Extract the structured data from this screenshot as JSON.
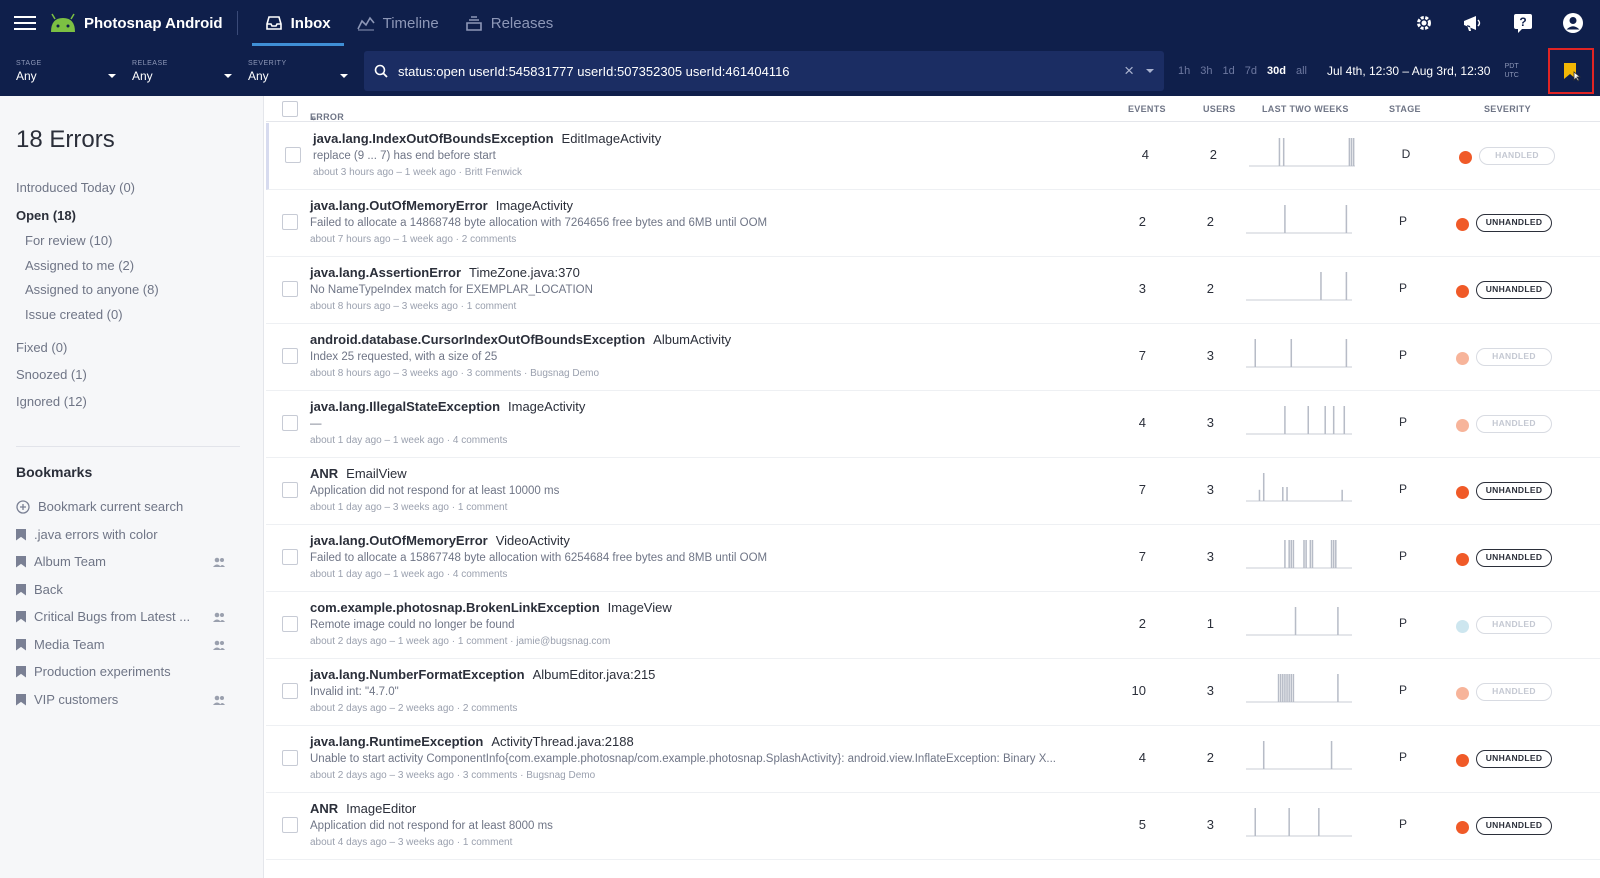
{
  "topbar": {
    "app_name": "Photosnap Android",
    "tabs": [
      {
        "label": "Inbox",
        "active": true,
        "icon": "inbox-icon"
      },
      {
        "label": "Timeline",
        "active": false,
        "icon": "timeline-icon"
      },
      {
        "label": "Releases",
        "active": false,
        "icon": "releases-icon"
      }
    ],
    "icons": [
      "settings-gear-icon",
      "megaphone-icon",
      "help-icon",
      "account-icon"
    ]
  },
  "filters": {
    "stage": {
      "label": "STAGE",
      "value": "Any"
    },
    "release": {
      "label": "RELEASE",
      "value": "Any"
    },
    "severity": {
      "label": "SEVERITY",
      "value": "Any"
    },
    "search_query": "status:open userId:545831777 userId:507352305 userId:461404116",
    "time_ranges": [
      "1h",
      "3h",
      "1d",
      "7d",
      "30d",
      "all"
    ],
    "active_range": "30d",
    "date_range": "Jul 4th, 12:30 – Aug 3rd, 12:30",
    "tz_top": "PDT",
    "tz_bottom": "UTC"
  },
  "sidebar": {
    "title": "18 Errors",
    "items": [
      {
        "label": "Introduced Today (0)"
      },
      {
        "label": "Open (18)"
      },
      {
        "label": "For review (10)"
      },
      {
        "label": "Assigned to me (2)"
      },
      {
        "label": "Assigned to anyone (8)"
      },
      {
        "label": "Issue created (0)"
      },
      {
        "label": "Fixed (0)"
      },
      {
        "label": "Snoozed (1)"
      },
      {
        "label": "Ignored (12)"
      }
    ],
    "bookmarks_title": "Bookmarks",
    "bookmarks": [
      {
        "label": "Bookmark current search"
      },
      {
        "label": ".java errors with color"
      },
      {
        "label": "Album Team"
      },
      {
        "label": "Back"
      },
      {
        "label": "Critical Bugs from Latest ..."
      },
      {
        "label": "Media Team"
      },
      {
        "label": "Production experiments"
      },
      {
        "label": "VIP customers"
      }
    ]
  },
  "table": {
    "headers": {
      "error": "ERROR",
      "events": "EVENTS",
      "users": "USERS",
      "trend": "LAST TWO WEEKS",
      "stage": "STAGE",
      "severity": "SEVERITY"
    },
    "rows": [
      {
        "name": "java.lang.IndexOutOfBoundsException",
        "context": "EditImageActivity",
        "message": "replace (9 ... 7) has end before start",
        "meta": "about 3 hours ago – 1 week ago  ·  Britt Fenwick",
        "events": "4",
        "users": "2",
        "stage": "D",
        "severity": "HANDLED",
        "dot_color": "#f05a28",
        "bars": [
          0,
          0,
          0,
          0,
          0,
          0,
          0,
          0,
          0,
          0,
          0,
          0,
          0,
          0,
          1,
          0,
          1,
          0,
          0,
          0,
          0,
          0,
          0,
          0,
          0,
          0,
          0,
          0,
          0,
          0,
          0,
          0,
          0,
          0,
          0,
          0,
          0,
          0,
          0,
          0,
          0,
          0,
          0,
          0,
          0,
          0,
          0,
          1,
          1,
          1
        ]
      },
      {
        "name": "java.lang.OutOfMemoryError",
        "context": "ImageActivity",
        "message": "Failed to allocate a 14868748 byte allocation with 7264656 free bytes and 6MB until OOM",
        "meta": "about 7 hours ago – 1 week ago  ·  2 comments",
        "events": "2",
        "users": "2",
        "stage": "P",
        "severity": "UNHANDLED",
        "dot_color": "#f05a28",
        "bars": [
          0,
          0,
          0,
          0,
          0,
          0,
          0,
          0,
          0,
          0,
          0,
          0,
          0,
          0,
          0,
          0,
          0,
          0,
          1,
          0,
          0,
          0,
          0,
          0,
          0,
          0,
          0,
          0,
          0,
          0,
          0,
          0,
          0,
          0,
          0,
          0,
          0,
          0,
          0,
          0,
          0,
          0,
          0,
          0,
          0,
          0,
          0,
          1,
          0,
          0
        ]
      },
      {
        "name": "java.lang.AssertionError",
        "context": "TimeZone.java:370",
        "message": "No NameTypeIndex match for EXEMPLAR_LOCATION",
        "meta": "about 8 hours ago – 3 weeks ago  ·  1 comment",
        "events": "3",
        "users": "2",
        "stage": "P",
        "severity": "UNHANDLED",
        "dot_color": "#f05a28",
        "bars": [
          0,
          0,
          0,
          0,
          0,
          0,
          0,
          0,
          0,
          0,
          0,
          0,
          0,
          0,
          0,
          0,
          0,
          0,
          0,
          0,
          0,
          0,
          0,
          0,
          0,
          0,
          0,
          0,
          0,
          0,
          0,
          0,
          0,
          0,
          0,
          1,
          0,
          0,
          0,
          0,
          0,
          0,
          0,
          0,
          0,
          0,
          0,
          1,
          0,
          0
        ]
      },
      {
        "name": "android.database.CursorIndexOutOfBoundsException",
        "context": "AlbumActivity",
        "message": "Index 25 requested, with a size of 25",
        "meta": "about 8 hours ago – 3 weeks ago  ·  3 comments  ·  Bugsnag Demo",
        "events": "7",
        "users": "3",
        "stage": "P",
        "severity": "HANDLED",
        "dot_color": "#f7b49a",
        "bars": [
          0,
          0,
          0,
          0,
          1,
          0,
          0,
          0,
          0,
          0,
          0,
          0,
          0,
          0,
          0,
          0,
          0,
          0,
          0,
          0,
          0,
          1,
          0,
          0,
          0,
          0,
          0,
          0,
          0,
          0,
          0,
          0,
          0,
          0,
          0,
          0,
          0,
          0,
          0,
          0,
          0,
          0,
          0,
          0,
          0,
          0,
          0,
          1,
          0,
          0
        ]
      },
      {
        "name": "java.lang.IllegalStateException",
        "context": "ImageActivity",
        "message": "—",
        "meta": "about 1 day ago – 1 week ago  ·  4 comments",
        "events": "4",
        "users": "3",
        "stage": "P",
        "severity": "HANDLED",
        "dot_color": "#f7b49a",
        "bars": [
          0,
          0,
          0,
          0,
          0,
          0,
          0,
          0,
          0,
          0,
          0,
          0,
          0,
          0,
          0,
          0,
          0,
          0,
          1,
          0,
          0,
          0,
          0,
          0,
          0,
          0,
          0,
          0,
          0,
          1,
          0,
          0,
          0,
          0,
          0,
          0,
          0,
          1,
          0,
          0,
          0,
          1,
          0,
          0,
          0,
          0,
          1,
          0,
          0,
          0
        ]
      },
      {
        "name": "ANR",
        "context": "EmailView",
        "message": "Application did not respond for at least 10000 ms",
        "meta": "about 1 day ago – 3 weeks ago  ·  1 comment",
        "events": "7",
        "users": "3",
        "stage": "P",
        "severity": "UNHANDLED",
        "dot_color": "#f05a28",
        "bars": [
          0,
          0,
          0,
          0,
          0,
          0,
          0.4,
          0,
          1,
          0,
          0,
          0,
          0,
          0,
          0,
          0,
          0,
          0.5,
          0,
          0.5,
          0,
          0,
          0,
          0,
          0,
          0,
          0,
          0,
          0,
          0,
          0,
          0,
          0,
          0,
          0,
          0,
          0,
          0,
          0,
          0,
          0,
          0,
          0,
          0,
          0,
          0.4,
          0,
          0,
          0,
          0
        ]
      },
      {
        "name": "java.lang.OutOfMemoryError",
        "context": "VideoActivity",
        "message": "Failed to allocate a 15867748 byte allocation with 6254684 free bytes and 8MB until OOM",
        "meta": "about 1 day ago – 1 week ago  ·  4 comments",
        "events": "7",
        "users": "3",
        "stage": "P",
        "severity": "UNHANDLED",
        "dot_color": "#f05a28",
        "bars": [
          0,
          0,
          0,
          0,
          0,
          0,
          0,
          0,
          0,
          0,
          0,
          0,
          0,
          0,
          0,
          0,
          0,
          0,
          1,
          0,
          1,
          1,
          1,
          0,
          0,
          0,
          0,
          1,
          1,
          0,
          1,
          1,
          0,
          0,
          0,
          0,
          0,
          0,
          0,
          0,
          1,
          1,
          1,
          0,
          0,
          0,
          0,
          0,
          0,
          0
        ]
      },
      {
        "name": "com.example.photosnap.BrokenLinkException",
        "context": "ImageView",
        "message": "Remote image could no longer be found",
        "meta": "about 2 days ago – 1 week ago  ·  1 comment  ·  jamie@bugsnag.com",
        "events": "2",
        "users": "1",
        "stage": "P",
        "severity": "HANDLED",
        "dot_color": "#cde6ef",
        "bars": [
          0,
          0,
          0,
          0,
          0,
          0,
          0,
          0,
          0,
          0,
          0,
          0,
          0,
          0,
          0,
          0,
          0,
          0,
          0,
          0,
          0,
          0,
          0,
          1,
          0,
          0,
          0,
          0,
          0,
          0,
          0,
          0,
          0,
          0,
          0,
          0,
          0,
          0,
          0,
          0,
          0,
          0,
          0,
          1,
          0,
          0,
          0,
          0,
          0,
          0
        ]
      },
      {
        "name": "java.lang.NumberFormatException",
        "context": "AlbumEditor.java:215",
        "message": "Invalid int: \"4.7.0\"",
        "meta": "about 2 days ago – 2 weeks ago  ·  2 comments",
        "events": "10",
        "users": "3",
        "stage": "P",
        "severity": "HANDLED",
        "dot_color": "#f7b49a",
        "bars": [
          0,
          0,
          0,
          0,
          0,
          0,
          0,
          0,
          0,
          0,
          0,
          0,
          0,
          0,
          0,
          1,
          1,
          1,
          1,
          1,
          1,
          1,
          1,
          0,
          0,
          0,
          0,
          0,
          0,
          0,
          0,
          0,
          0,
          0,
          0,
          0,
          0,
          0,
          0,
          0,
          0,
          0,
          0,
          1,
          0,
          0,
          0,
          0,
          0,
          0
        ]
      },
      {
        "name": "java.lang.RuntimeException",
        "context": "ActivityThread.java:2188",
        "message": "Unable to start activity ComponentInfo{com.example.photosnap/com.example.photosnap.SplashActivity}: android.view.InflateException: Binary X...",
        "meta": "about 2 days ago – 3 weeks ago  ·  3 comments  ·  Bugsnag Demo",
        "events": "4",
        "users": "2",
        "stage": "P",
        "severity": "UNHANDLED",
        "dot_color": "#f05a28",
        "bars": [
          0,
          0,
          0,
          0,
          0,
          0,
          0,
          0,
          1,
          0,
          0,
          0,
          0,
          0,
          0,
          0,
          0,
          0,
          0,
          0,
          0,
          0,
          0,
          0,
          0,
          0,
          0,
          0,
          0,
          0,
          0,
          0,
          0,
          0,
          0,
          0,
          0,
          0,
          0,
          0,
          1,
          0,
          0,
          0,
          0,
          0,
          0,
          0,
          0,
          0
        ]
      },
      {
        "name": "ANR",
        "context": "ImageEditor",
        "message": "Application did not respond for at least 8000 ms",
        "meta": "about 4 days ago – 3 weeks ago  ·  1 comment",
        "events": "5",
        "users": "3",
        "stage": "P",
        "severity": "UNHANDLED",
        "dot_color": "#f05a28",
        "bars": [
          0,
          0,
          0,
          0,
          1,
          0,
          0,
          0,
          0,
          0,
          0,
          0,
          0,
          0,
          0,
          0,
          0,
          0,
          0,
          0,
          1,
          0,
          0,
          0,
          0,
          0,
          0,
          0,
          0,
          0,
          0,
          0,
          0,
          0,
          1,
          0,
          0,
          0,
          0,
          0,
          0,
          0,
          0,
          0,
          0,
          0,
          0,
          0,
          0,
          0
        ]
      }
    ]
  }
}
